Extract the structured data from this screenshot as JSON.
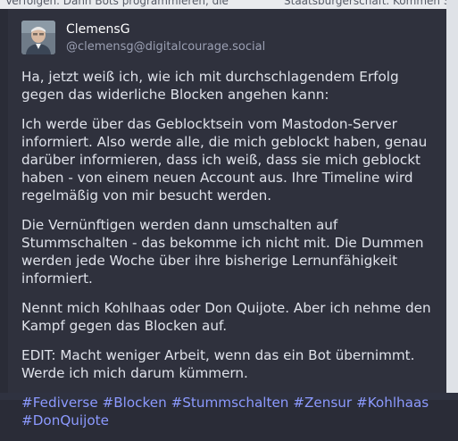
{
  "background": {
    "top_left_fragment": "Verfolgen. Dann Bots programmieren, die",
    "top_right_fragment": "Staatsbürgerschaft. Kommen Sie z"
  },
  "post": {
    "display_name": "ClemensG",
    "handle": "@clemensg@digitalcourage.social",
    "paragraphs": [
      "Ha, jetzt weiß ich, wie ich mit durchschlagendem Erfolg gegen das widerliche Blocken angehen kann:",
      "Ich werde über das Geblocktsein vom Mastodon-Server informiert. Also werde alle, die mich geblockt haben, genau darüber informieren, dass ich weiß, dass sie mich geblockt haben - von einem neuen Account aus. Ihre Timeline wird regelmäßig von mir besucht werden.",
      "Die Vernünftigen werden dann umschalten auf Stummschalten - das bekomme ich nicht mit. Die Dummen werden jede Woche über ihre bisherige Lernunfähigkeit informiert.",
      "Nennt mich Kohlhaas oder Don Quijote. Aber ich nehme den Kampf gegen das Blocken auf.",
      "EDIT: Macht weniger Arbeit, wenn das ein Bot übernimmt. Werde ich mich darum kümmern."
    ],
    "hashtags": [
      "#Fediverse",
      "#Blocken",
      "#Stummschalten",
      "#Zensur",
      "#Kohlhaas",
      "#DonQuijote"
    ]
  },
  "colors": {
    "card_background": "#2f313d",
    "text": "#dfe2ea",
    "hashtag": "#8c9aff",
    "handle": "#9ba0b3"
  }
}
